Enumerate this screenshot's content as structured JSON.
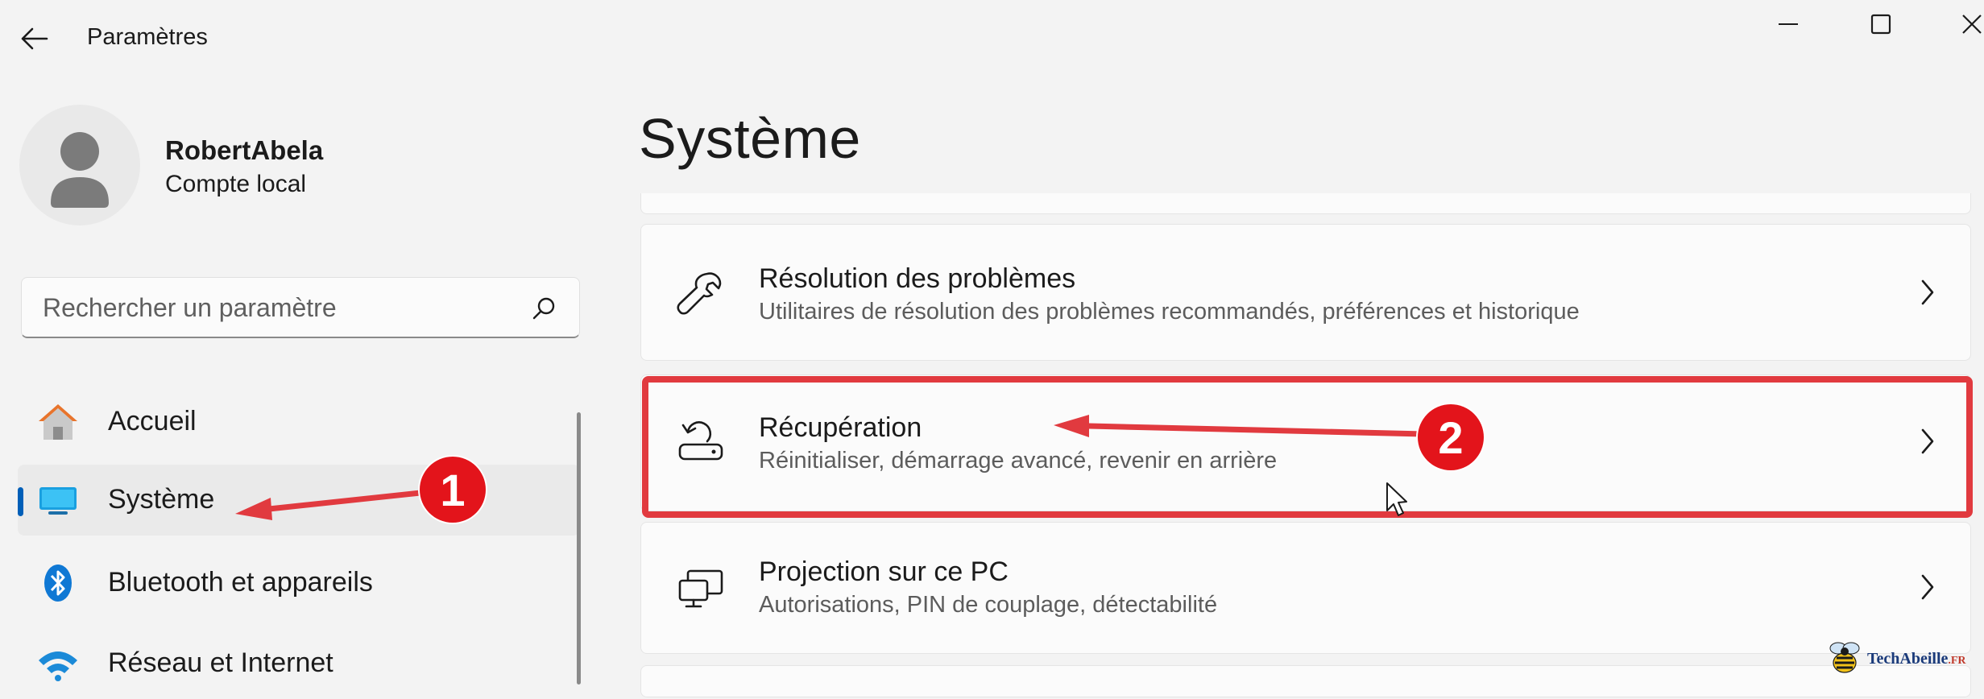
{
  "window": {
    "title": "Paramètres"
  },
  "profile": {
    "name": "RobertAbela",
    "account_type": "Compte local"
  },
  "search": {
    "placeholder": "Rechercher un paramètre"
  },
  "nav": {
    "items": [
      {
        "label": "Accueil",
        "icon": "home-icon"
      },
      {
        "label": "Système",
        "icon": "system-display-icon",
        "selected": true
      },
      {
        "label": "Bluetooth et appareils",
        "icon": "bluetooth-icon"
      },
      {
        "label": "Réseau et Internet",
        "icon": "wifi-icon"
      }
    ]
  },
  "main": {
    "title": "Système",
    "cards": [
      {
        "title": "Résolution des problèmes",
        "description": "Utilitaires de résolution des problèmes recommandés, préférences et historique",
        "icon": "wrench-icon"
      },
      {
        "title": "Récupération",
        "description": "Réinitialiser, démarrage avancé, revenir en arrière",
        "icon": "recovery-icon"
      },
      {
        "title": "Projection sur ce PC",
        "description": "Autorisations, PIN de couplage, détectabilité",
        "icon": "projection-icon"
      }
    ]
  },
  "annotations": {
    "step1": "1",
    "step2": "2",
    "color": "#e3141b"
  },
  "watermark": {
    "text": "TechAbeille",
    "suffix": ".FR"
  },
  "colors": {
    "accent": "#005fb8",
    "highlight": "#e13a3f",
    "background": "#f3f3f3",
    "card": "#fbfbfb"
  }
}
